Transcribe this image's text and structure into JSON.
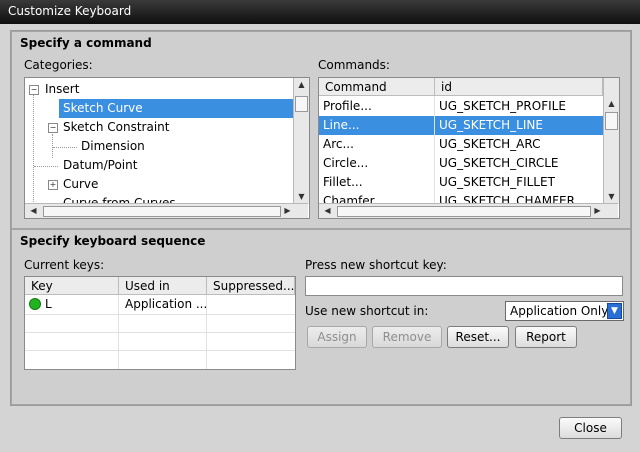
{
  "window": {
    "title": "Customize Keyboard"
  },
  "specify_command": {
    "title": "Specify a command",
    "categories_label": "Categories:",
    "categories": [
      {
        "label": "Insert",
        "expander": "−"
      },
      {
        "label": "Sketch Curve",
        "selected": true
      },
      {
        "label": "Sketch Constraint",
        "expander": "−"
      },
      {
        "label": "Dimension"
      },
      {
        "label": "Datum/Point"
      },
      {
        "label": "Curve",
        "expander": "+"
      },
      {
        "label": "Curve from Curves"
      }
    ],
    "commands_label": "Commands:",
    "commands_headers": [
      "Command",
      "id"
    ],
    "commands": [
      {
        "command": "Profile...",
        "id": "UG_SKETCH_PROFILE"
      },
      {
        "command": "Line...",
        "id": "UG_SKETCH_LINE",
        "selected": true
      },
      {
        "command": "Arc...",
        "id": "UG_SKETCH_ARC"
      },
      {
        "command": "Circle...",
        "id": "UG_SKETCH_CIRCLE"
      },
      {
        "command": "Fillet...",
        "id": "UG_SKETCH_FILLET"
      },
      {
        "command": "Chamfer...",
        "id": "UG_SKETCH_CHAMFER"
      }
    ]
  },
  "keyboard_sequence": {
    "title": "Specify keyboard sequence",
    "current_keys_label": "Current keys:",
    "keys_headers": [
      "Key",
      "Used in",
      "Suppressed..."
    ],
    "keys": [
      {
        "key": "L",
        "used_in": "Application ...",
        "suppressed": ""
      }
    ],
    "press_label": "Press new shortcut key:",
    "shortcut_value": "",
    "use_in_label": "Use new shortcut in:",
    "use_in_value": "Application Only",
    "buttons": {
      "assign": "Assign",
      "remove": "Remove",
      "reset": "Reset...",
      "report": "Report"
    }
  },
  "footer": {
    "close": "Close"
  },
  "colors": {
    "selection": "#3b8fe0",
    "key_status": "#22b322",
    "dropdown_arrow": "#2a6fd6"
  }
}
